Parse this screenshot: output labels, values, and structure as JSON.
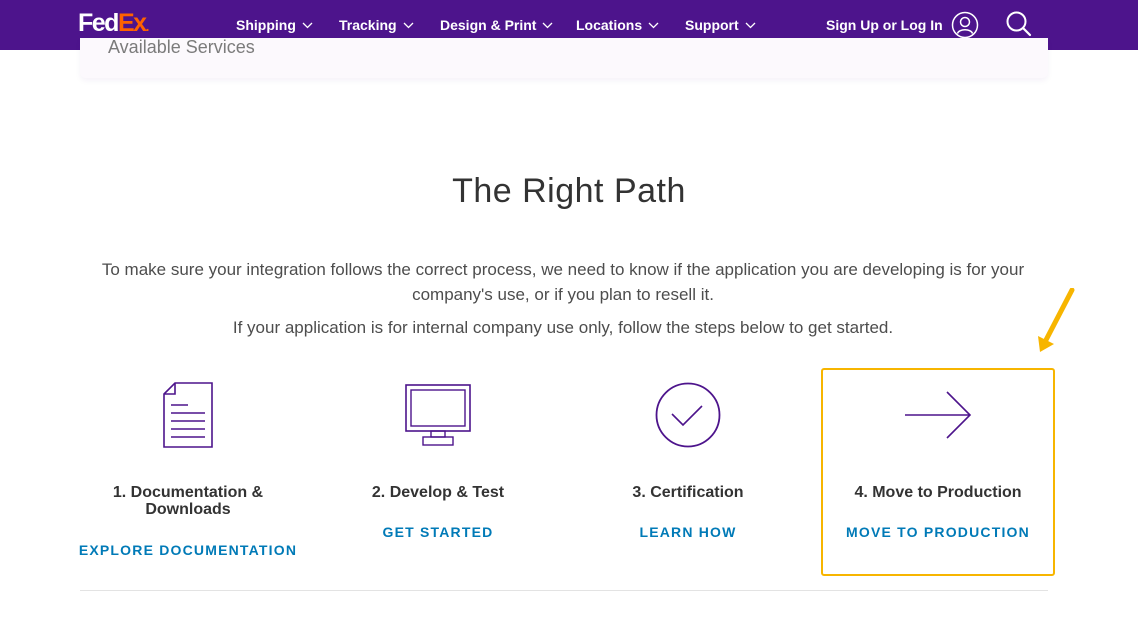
{
  "header": {
    "logo_fed": "Fed",
    "logo_ex": "Ex",
    "nav": [
      {
        "label": "Shipping"
      },
      {
        "label": "Tracking"
      },
      {
        "label": "Design & Print"
      },
      {
        "label": "Locations"
      },
      {
        "label": "Support"
      }
    ],
    "login_label": "Sign Up or Log In"
  },
  "previous_section": {
    "partial_text": "Available Services"
  },
  "main": {
    "title": "The Right Path",
    "intro": "To make sure your integration follows the correct process, we need to know if the application you are developing is for your company's use, or if you plan to resell it.",
    "instruction": "If your application is for internal company use only, follow the steps below to get started.",
    "steps": [
      {
        "title": "1. Documentation & Downloads",
        "link": "EXPLORE DOCUMENTATION",
        "icon": "document-icon"
      },
      {
        "title": "2. Develop & Test",
        "link": "GET STARTED",
        "icon": "monitor-icon"
      },
      {
        "title": "3. Certification",
        "link": "LEARN HOW",
        "icon": "checkmark-circle-icon"
      },
      {
        "title": "4. Move to Production",
        "link": "MOVE TO PRODUCTION",
        "icon": "arrow-right-icon"
      }
    ]
  },
  "colors": {
    "brand_purple": "#4d148c",
    "brand_orange": "#ff6200",
    "link_blue": "#007ab7",
    "highlight_yellow": "#f7b500"
  }
}
